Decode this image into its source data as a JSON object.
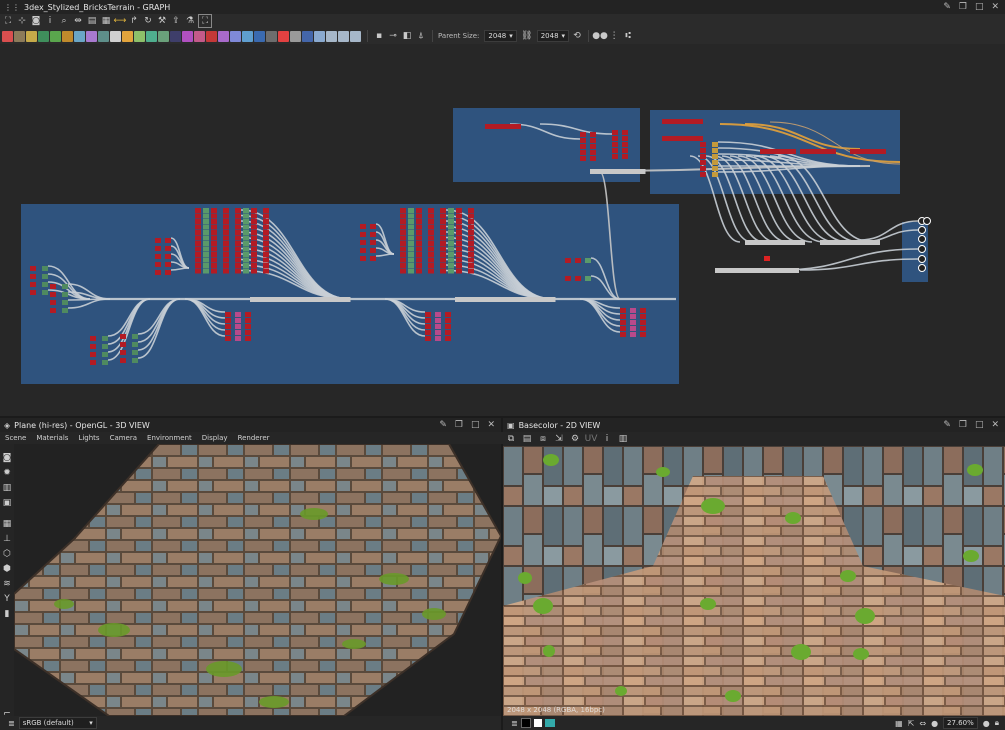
{
  "graph": {
    "title": "3dex_Stylized_BricksTerrain - GRAPH",
    "parent_size_label": "Parent Size:",
    "parent_size_value": "2048",
    "output_size_value": "2048",
    "node_icon_colors": [
      "#d94f4f",
      "#8c7b5a",
      "#c6aa49",
      "#3f8f5c",
      "#5aa64d",
      "#c08a2c",
      "#6aa6c6",
      "#a87ad0",
      "#5e8f8a",
      "#d0d0d0",
      "#e3a43c",
      "#8dc06a",
      "#4fae8e",
      "#6aa07a",
      "#3e3e6a",
      "#b050c0",
      "#c35a8a",
      "#c43838",
      "#a86acb",
      "#7f89d8",
      "#5f9fd0",
      "#3a6ab0",
      "#6d6d6d",
      "#e24141",
      "#9a9a9a",
      "#4466aa",
      "#8aaad0",
      "#a6b7c9",
      "#a6b7c9",
      "#a6b7c9"
    ]
  },
  "view3d": {
    "title": "Plane (hi-res) - OpenGL - 3D VIEW",
    "menu": [
      "Scene",
      "Materials",
      "Lights",
      "Camera",
      "Environment",
      "Display",
      "Renderer"
    ],
    "colorspace": "sRGB (default)"
  },
  "view2d": {
    "title": "Basecolor - 2D VIEW",
    "status": "2048 x 2048 (RGBA, 16bpc)",
    "zoom": "27.60%"
  },
  "colors": {
    "graph_bg": "#272727",
    "frame": "#2f537e",
    "node_red": "#b31b24",
    "link": "#c9cfd6"
  }
}
